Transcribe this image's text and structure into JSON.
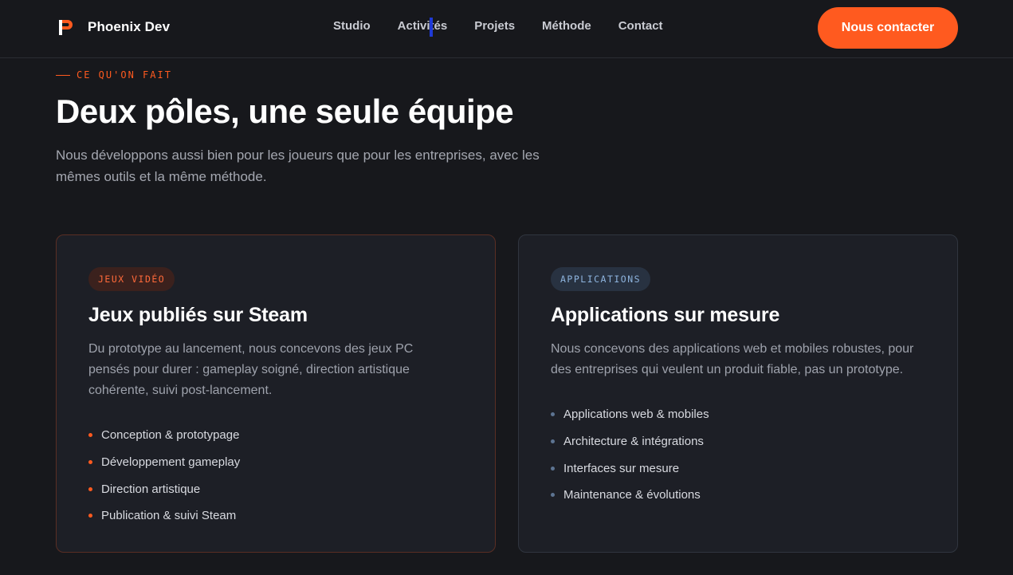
{
  "header": {
    "brand_name": "Phoenix Dev",
    "nav": [
      "Studio",
      "Activités",
      "Projets",
      "Méthode",
      "Contact"
    ],
    "cta_label": "Nous contacter"
  },
  "section": {
    "eyebrow": "CE QU'ON FAIT",
    "title": "Deux pôles, une seule équipe",
    "lead": "Nous développons aussi bien pour les joueurs que pour les entreprises, avec les mêmes outils et la même méthode."
  },
  "cards": [
    {
      "tag": "JEUX VIDÉO",
      "title": "Jeux publiés sur Steam",
      "description": "Du prototype au lancement, nous concevons des jeux PC pensés pour durer : gameplay soigné, direction artistique cohérente, suivi post-lancement.",
      "features": [
        "Conception & prototypage",
        "Développement gameplay",
        "Direction artistique",
        "Publication & suivi Steam"
      ]
    },
    {
      "tag": "APPLICATIONS",
      "title": "Applications sur mesure",
      "description": "Nous concevons des applications web et mobiles robustes, pour des entreprises qui veulent un produit fiable, pas un prototype.",
      "features": [
        "Applications web & mobiles",
        "Architecture & intégrations",
        "Interfaces sur mesure",
        "Maintenance & évolutions"
      ]
    }
  ],
  "colors": {
    "accent": "#ff5a1f",
    "background": "#17181c",
    "card": "#1d1f26",
    "apps_accent": "#8eb4de"
  },
  "icons": {
    "brand_logo": "phoenix-p-logo-icon"
  }
}
